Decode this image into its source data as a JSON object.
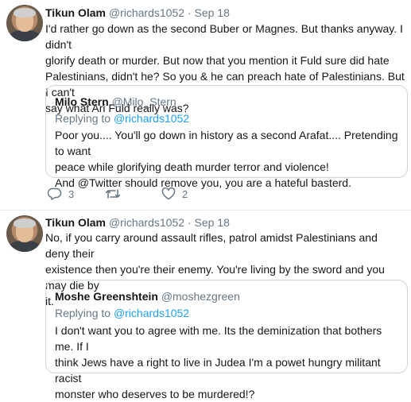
{
  "tweets": [
    {
      "author_name": "Tikun Olam",
      "author_handle": "@richards1052",
      "separator": "·",
      "date": "Sep 18",
      "text_lines": [
        "I'd rather go down as the second Buber or Magnes. But thanks anyway.  I didn't",
        "glorify death or murder.  But now that you mention it Fuld sure did hate",
        "Palestinians, didn't he? So you & he can preach hate of Palestinians.  But I can't",
        "say what Ari Fuld really was?"
      ],
      "quote": {
        "author_name": "Milo Stern",
        "author_handle": "@Milo_Stern",
        "replying_prefix": "Replying to",
        "replying_to": "@richards1052",
        "text_lines": [
          "Poor you.... You'll go down in history as a second Arafat.... Pretending to want",
          "peace while glorifying death murder terror and violence!",
          "And @Twitter should remove you, you are a hateful basterd."
        ]
      },
      "actions": {
        "replies": "3",
        "retweets": "",
        "likes": "2"
      }
    },
    {
      "author_name": "Tikun Olam",
      "author_handle": "@richards1052",
      "separator": "·",
      "date": "Sep 18",
      "text_lines": [
        "No, if you carry around assault rifles, patrol amidst Palestinians and deny their",
        "existence then you're their enemy.  You're living by the sword and you may die by",
        "it."
      ],
      "quote": {
        "author_name": "Moshe Greenshtein",
        "author_handle": "@moshezgreen",
        "replying_prefix": "Replying to",
        "replying_to": "@richards1052",
        "text_lines": [
          "I don't want you to agree with me. Its the deminization that bothers me. If I",
          "think Jews have a right to live in Judea I'm a powet hungry militant racist",
          "monster who deserves to be murdered!?"
        ]
      }
    }
  ],
  "colors": {
    "text": "#14171a",
    "secondary": "#657786",
    "link": "#1da1f2",
    "border": "#ccd6dd"
  },
  "icons": [
    "reply-icon",
    "retweet-icon",
    "like-icon"
  ]
}
